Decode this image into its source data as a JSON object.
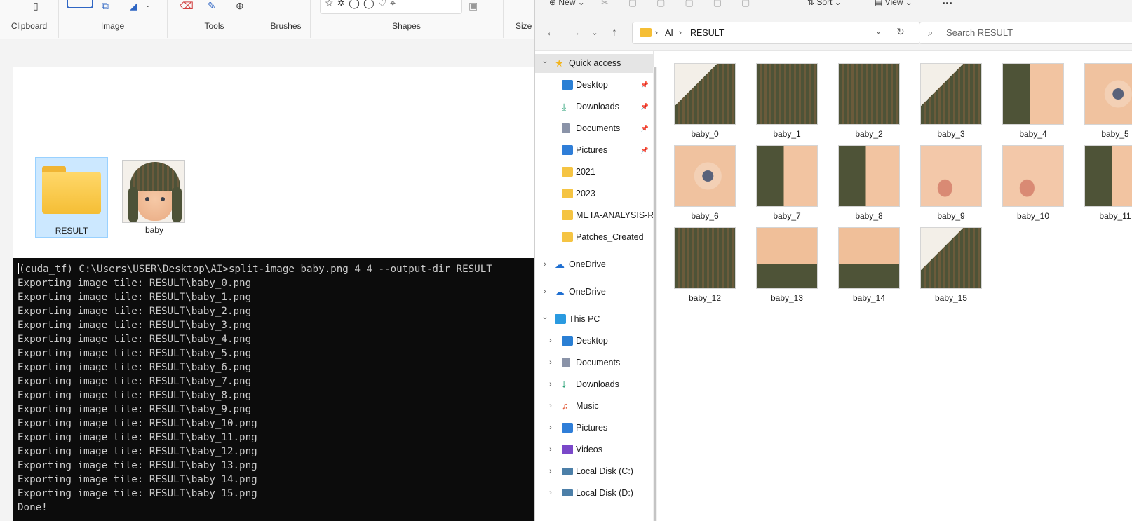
{
  "paint": {
    "ribbon_groups": [
      "Clipboard",
      "Image",
      "Tools",
      "Brushes",
      "Shapes",
      "Size"
    ],
    "desktop_items": [
      {
        "label": "RESULT",
        "type": "folder",
        "selected": true
      },
      {
        "label": "baby",
        "type": "image"
      }
    ]
  },
  "terminal": {
    "lines": [
      "(cuda_tf) C:\\Users\\USER\\Desktop\\AI>split-image baby.png 4 4 --output-dir RESULT",
      "Exporting image tile: RESULT\\baby_0.png",
      "Exporting image tile: RESULT\\baby_1.png",
      "Exporting image tile: RESULT\\baby_2.png",
      "Exporting image tile: RESULT\\baby_3.png",
      "Exporting image tile: RESULT\\baby_4.png",
      "Exporting image tile: RESULT\\baby_5.png",
      "Exporting image tile: RESULT\\baby_6.png",
      "Exporting image tile: RESULT\\baby_7.png",
      "Exporting image tile: RESULT\\baby_8.png",
      "Exporting image tile: RESULT\\baby_9.png",
      "Exporting image tile: RESULT\\baby_10.png",
      "Exporting image tile: RESULT\\baby_11.png",
      "Exporting image tile: RESULT\\baby_12.png",
      "Exporting image tile: RESULT\\baby_13.png",
      "Exporting image tile: RESULT\\baby_14.png",
      "Exporting image tile: RESULT\\baby_15.png",
      "Done!"
    ]
  },
  "explorer": {
    "toolbar": {
      "new_label": "New",
      "sort_label": "Sort",
      "view_label": "View",
      "more_label": "..."
    },
    "address": {
      "crumbs": [
        "AI",
        "RESULT"
      ]
    },
    "search": {
      "placeholder": "Search RESULT"
    },
    "nav": [
      {
        "label": "Quick access",
        "icon": "star-icon",
        "level": 0,
        "expanded": true,
        "selected": true
      },
      {
        "label": "Desktop",
        "icon": "desktop-icon",
        "level": 1,
        "pinned": true
      },
      {
        "label": "Downloads",
        "icon": "download-icon",
        "level": 1,
        "pinned": true
      },
      {
        "label": "Documents",
        "icon": "document-icon",
        "level": 1,
        "pinned": true
      },
      {
        "label": "Pictures",
        "icon": "pictures-icon",
        "level": 1,
        "pinned": true
      },
      {
        "label": "2021",
        "icon": "folder-icon",
        "level": 1
      },
      {
        "label": "2023",
        "icon": "folder-icon",
        "level": 1
      },
      {
        "label": "META-ANALYSIS-RI",
        "icon": "folder-icon",
        "level": 1
      },
      {
        "label": "Patches_Created",
        "icon": "folder-icon",
        "level": 1
      },
      {
        "label": "OneDrive",
        "icon": "cloud-icon",
        "level": 0,
        "expanded": false
      },
      {
        "label": "OneDrive",
        "icon": "cloud-icon",
        "level": 0,
        "expanded": false
      },
      {
        "label": "This PC",
        "icon": "pc-icon",
        "level": 0,
        "expanded": true
      },
      {
        "label": "Desktop",
        "icon": "desktop-icon",
        "level": 1,
        "expanded": false
      },
      {
        "label": "Documents",
        "icon": "document-icon",
        "level": 1,
        "expanded": false
      },
      {
        "label": "Downloads",
        "icon": "download-icon",
        "level": 1,
        "expanded": false
      },
      {
        "label": "Music",
        "icon": "music-icon",
        "level": 1,
        "expanded": false
      },
      {
        "label": "Pictures",
        "icon": "pictures-icon",
        "level": 1,
        "expanded": false
      },
      {
        "label": "Videos",
        "icon": "video-icon",
        "level": 1,
        "expanded": false
      },
      {
        "label": "Local Disk (C:)",
        "icon": "drive-icon",
        "level": 1,
        "expanded": false
      },
      {
        "label": "Local Disk (D:)",
        "icon": "drive-icon",
        "level": 1,
        "expanded": false
      }
    ],
    "files": [
      {
        "name": "baby_0",
        "tone": "hat-light"
      },
      {
        "name": "baby_1",
        "tone": "hat"
      },
      {
        "name": "baby_2",
        "tone": "hat"
      },
      {
        "name": "baby_3",
        "tone": "hat-light"
      },
      {
        "name": "baby_4",
        "tone": "hat-skin"
      },
      {
        "name": "baby_5",
        "tone": "eye"
      },
      {
        "name": "baby_6",
        "tone": "eye"
      },
      {
        "name": "baby_7",
        "tone": "hat-skin"
      },
      {
        "name": "baby_8",
        "tone": "hat-skin"
      },
      {
        "name": "baby_9",
        "tone": "skin-lip"
      },
      {
        "name": "baby_10",
        "tone": "skin-lip"
      },
      {
        "name": "baby_11",
        "tone": "hat-skin"
      },
      {
        "name": "baby_12",
        "tone": "hat"
      },
      {
        "name": "baby_13",
        "tone": "skin-hat"
      },
      {
        "name": "baby_14",
        "tone": "skin-hat"
      },
      {
        "name": "baby_15",
        "tone": "hat-light"
      }
    ]
  },
  "colors": {
    "selection": "#cce8ff",
    "terminal_bg": "#0c0c0c",
    "terminal_fg": "#cccccc",
    "folder": "#f5be35"
  }
}
